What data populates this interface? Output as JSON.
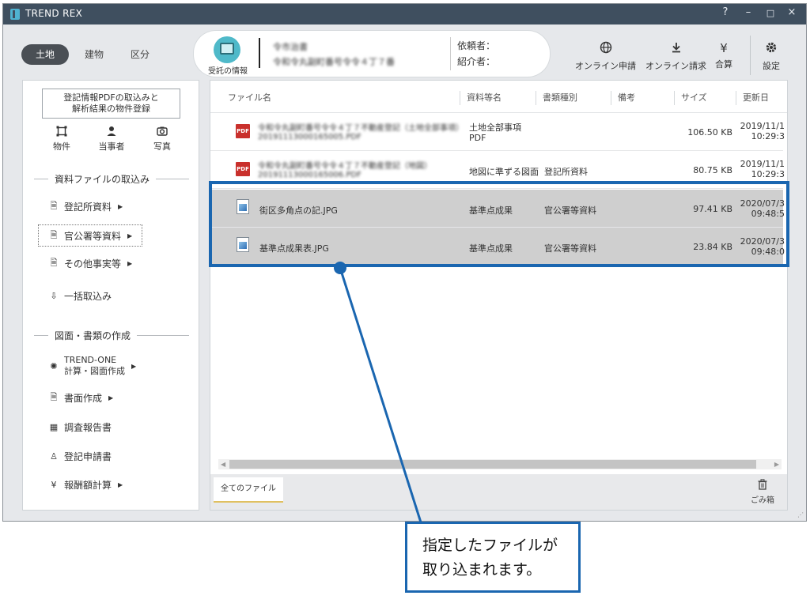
{
  "window": {
    "title": "TREND REX",
    "controls": {
      "help": "?",
      "minimize": "–",
      "maximize": "□",
      "close": "×"
    }
  },
  "segments": [
    {
      "label": "土地",
      "active": true
    },
    {
      "label": "建物",
      "active": false
    },
    {
      "label": "区分",
      "active": false
    }
  ],
  "client": {
    "icon_label": "受託の情報",
    "name_blurred": "令市治書",
    "address_blurred": "令和令丸副町番号令令４丁７番",
    "requester_label": "依頼者：",
    "introducer_label": "紹介者："
  },
  "tools": [
    {
      "label": "オンライン申請",
      "icon": "globe-icon"
    },
    {
      "label": "オンライン請求",
      "icon": "download-icon"
    },
    {
      "label": "合算",
      "icon": "yen-icon"
    },
    {
      "label": "設定",
      "icon": "gear-icon"
    }
  ],
  "left_panel": {
    "pdf_import_button": "登記情報PDFの取込みと\n解析結果の物件登録",
    "mini_buttons": [
      {
        "label": "物件",
        "icon": "property-icon"
      },
      {
        "label": "当事者",
        "icon": "person-icon"
      },
      {
        "label": "写真",
        "icon": "camera-icon"
      }
    ],
    "section_import": "資料ファイルの取込み",
    "import_items": [
      {
        "label": "登記所資料",
        "has_arrow": true
      },
      {
        "label": "官公署等資料",
        "has_arrow": true,
        "focused": true
      },
      {
        "label": "その他事実等",
        "has_arrow": true
      },
      {
        "label": "一括取込み",
        "has_arrow": false
      }
    ],
    "section_create": "図面・書類の作成",
    "create_items": [
      {
        "label_line1": "TREND-ONE",
        "label_line2": "計算・図面作成",
        "has_arrow": true
      },
      {
        "label": "書面作成",
        "has_arrow": true
      },
      {
        "label": "調査報告書",
        "has_arrow": false
      },
      {
        "label": "登記申請書",
        "has_arrow": false
      },
      {
        "label": "報酬額計算",
        "has_arrow": true,
        "icon_char": "¥"
      }
    ]
  },
  "file_table": {
    "columns": [
      "ファイル名",
      "資料等名",
      "書類種別",
      "備考",
      "サイズ",
      "更新日"
    ],
    "rows": [
      {
        "type": "pdf",
        "name_blurred": "令和令丸副町番号令令４丁７不動産登記（土地全部事項）",
        "name_blurred2": "20191113000165005.PDF",
        "doc_name": "土地全部事項",
        "doc_name2": "PDF",
        "doc_type": "",
        "note": "",
        "size": "106.50 KB",
        "date": "2019/11/1",
        "time": "10:29:3",
        "selected": false
      },
      {
        "type": "pdf",
        "name_blurred": "令和令丸副町番号令令４丁７不動産登記（地図）",
        "name_blurred2": "20191113000165006.PDF",
        "doc_name": "地図に準ずる図面",
        "doc_name2": "",
        "doc_type": "登記所資料",
        "note": "",
        "size": "80.75 KB",
        "date": "2019/11/1",
        "time": "10:29:3",
        "selected": false
      },
      {
        "type": "image",
        "name": "街区多角点の記.JPG",
        "doc_name": "基準点成果",
        "doc_name2": "",
        "doc_type": "官公署等資料",
        "note": "",
        "size": "97.41 KB",
        "date": "2020/07/3",
        "time": "09:48:5",
        "selected": true
      },
      {
        "type": "image",
        "name": "基準点成果表.JPG",
        "doc_name": "基準点成果",
        "doc_name2": "",
        "doc_type": "官公署等資料",
        "note": "",
        "size": "23.84 KB",
        "date": "2020/07/3",
        "time": "09:48:0",
        "selected": true
      }
    ]
  },
  "footer": {
    "tab_all_files": "全てのファイル",
    "trash_label": "ごみ箱"
  },
  "callout": {
    "line1": "指定したファイルが",
    "line2": "取り込まれます。",
    "color": "#1a66b0"
  }
}
